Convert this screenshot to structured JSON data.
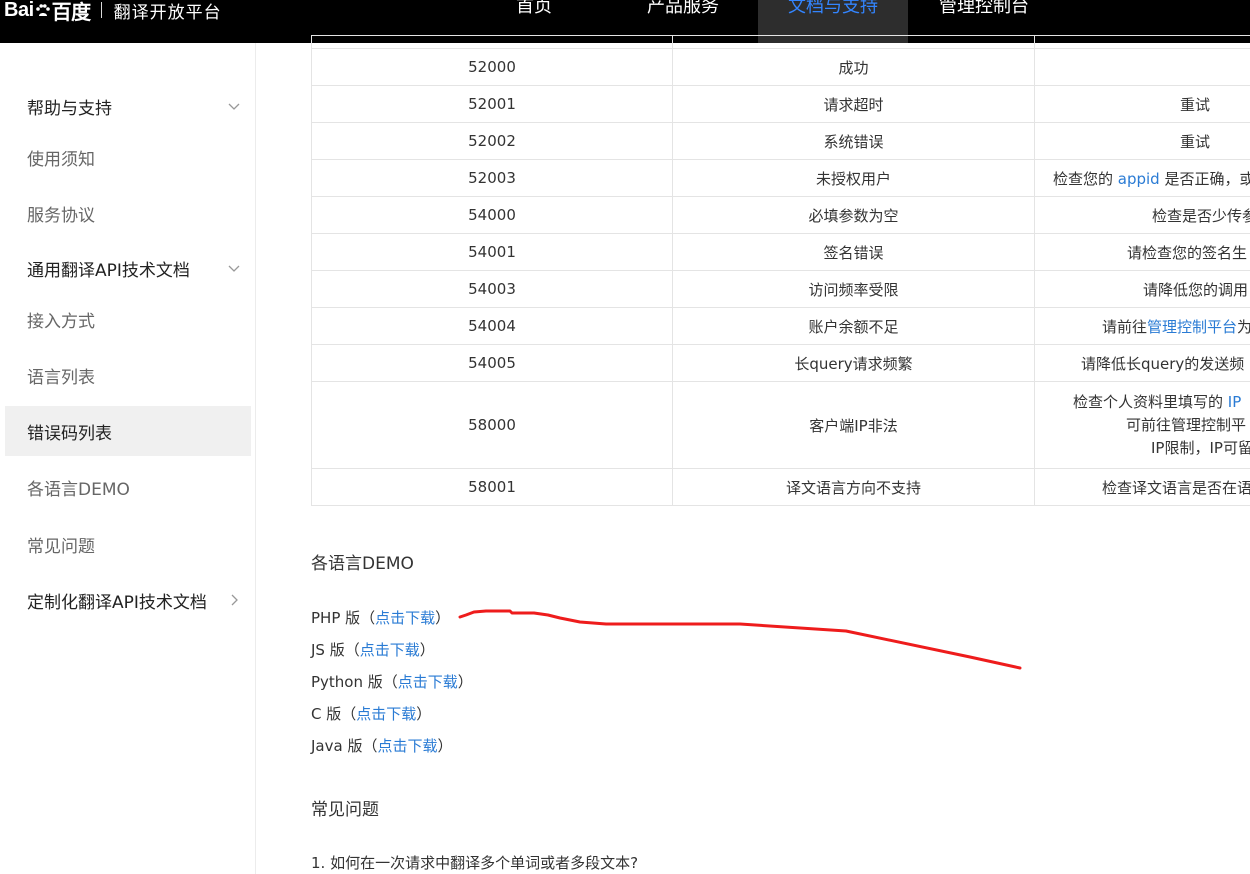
{
  "header": {
    "logo_text_latin": "Bai",
    "logo_text_cn": "百度",
    "platform": "翻译开放平台",
    "nav": [
      {
        "label": "首页",
        "active": false
      },
      {
        "label": "产品服务",
        "active": false
      },
      {
        "label": "文档与支持",
        "active": true
      },
      {
        "label": "管理控制台",
        "active": false
      }
    ]
  },
  "sidebar": {
    "items": [
      {
        "label": "帮助与支持",
        "type": "group",
        "chevron": "down"
      },
      {
        "label": "使用须知",
        "type": "sub"
      },
      {
        "label": "服务协议",
        "type": "sub"
      },
      {
        "label": "通用翻译API技术文档",
        "type": "group",
        "chevron": "down"
      },
      {
        "label": "接入方式",
        "type": "sub"
      },
      {
        "label": "语言列表",
        "type": "sub"
      },
      {
        "label": "错误码列表",
        "type": "sub",
        "selected": true
      },
      {
        "label": "各语言DEMO",
        "type": "sub"
      },
      {
        "label": "常见问题",
        "type": "sub"
      },
      {
        "label": "定制化翻译API技术文档",
        "type": "group",
        "chevron": "right"
      }
    ]
  },
  "error_table": {
    "rows": [
      {
        "code": "52000",
        "meaning": "成功",
        "solution": [
          ""
        ]
      },
      {
        "code": "52001",
        "meaning": "请求超时",
        "solution": [
          "重试"
        ]
      },
      {
        "code": "52002",
        "meaning": "系统错误",
        "solution": [
          "重试"
        ]
      },
      {
        "code": "52003",
        "meaning": "未授权用户",
        "solution_pre": "检查您的 ",
        "solution_link": "appid",
        "solution_post": " 是否正确，或"
      },
      {
        "code": "54000",
        "meaning": "必填参数为空",
        "solution": [
          "检查是否少传参"
        ]
      },
      {
        "code": "54001",
        "meaning": "签名错误",
        "solution": [
          "请检查您的签名生"
        ]
      },
      {
        "code": "54003",
        "meaning": "访问频率受限",
        "solution": [
          "请降低您的调用"
        ]
      },
      {
        "code": "54004",
        "meaning": "账户余额不足",
        "solution_pre": "请前往",
        "solution_link": "管理控制平台",
        "solution_post": "为"
      },
      {
        "code": "54005",
        "meaning": "长query请求频繁",
        "solution": [
          "请降低长query的发送频"
        ]
      },
      {
        "code": "58000",
        "meaning": "客户端IP非法",
        "solution_lines": [
          {
            "pre": "检查个人资料里填写的 ",
            "link": "IP"
          },
          {
            "pre": "可前往管理控制平"
          },
          {
            "pre": "IP限制，IP可留"
          }
        ]
      },
      {
        "code": "58001",
        "meaning": "译文语言方向不支持",
        "solution": [
          "检查译文语言是否在语"
        ]
      }
    ]
  },
  "demo": {
    "title": "各语言DEMO",
    "items": [
      {
        "lang": "PHP 版",
        "open": "（",
        "link": "点击下载",
        "close": "）"
      },
      {
        "lang": "JS 版",
        "open": "（",
        "link": "点击下载",
        "close": "）"
      },
      {
        "lang": "Python 版",
        "open": "（",
        "link": "点击下载",
        "close": "）"
      },
      {
        "lang": "C 版",
        "open": "（",
        "link": "点击下载",
        "close": "）"
      },
      {
        "lang": "Java 版",
        "open": "（",
        "link": "点击下载",
        "close": "）"
      }
    ]
  },
  "faq": {
    "title": "常见问题",
    "q1": "1. 如何在一次请求中翻译多个单词或者多段文本?"
  },
  "colors": {
    "topbar": "#000000",
    "nav_active_bg": "#2d2d2d",
    "nav_active_text": "#3385ff",
    "link": "#2a7bd4",
    "annotation": "#ee1c1c"
  },
  "icons": [
    "baidu-paw-icon",
    "chevron-down-icon",
    "chevron-right-icon"
  ]
}
